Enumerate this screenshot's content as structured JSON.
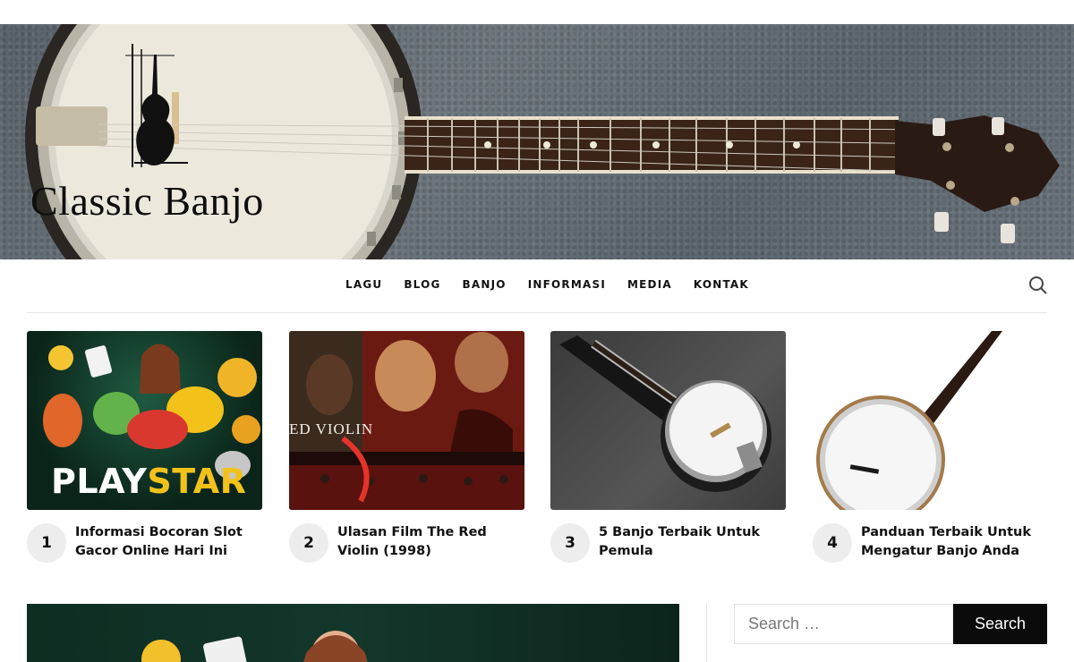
{
  "site": {
    "title": "Classic Banjo"
  },
  "nav": {
    "items": [
      "LAGU",
      "BLOG",
      "BANJO",
      "INFORMASI",
      "MEDIA",
      "KONTAK"
    ]
  },
  "featured": [
    {
      "number": "1",
      "title": "Informasi Bocoran Slot Gacor Online Hari Ini",
      "image_text": "PLAYSTAR"
    },
    {
      "number": "2",
      "title": "Ulasan Film The Red Violin (1998)",
      "image_text": "ED VIOLIN"
    },
    {
      "number": "3",
      "title": "5 Banjo Terbaik Untuk Pemula"
    },
    {
      "number": "4",
      "title": "Panduan Terbaik Untuk Mengatur Banjo Anda"
    }
  ],
  "sidebar": {
    "search_placeholder": "Search …",
    "search_button": "Search"
  },
  "colors": {
    "accent": "#0b0b0b",
    "number_bg": "#ededed",
    "playstar_yellow": "#f2c21b"
  }
}
